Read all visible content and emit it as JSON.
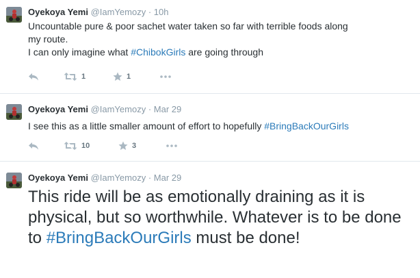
{
  "tweets": [
    {
      "name": "Oyekoya Yemi",
      "handle": "@IamYemozy",
      "dot": "·",
      "time": "10h",
      "text_line1": "Uncountable pure & poor sachet water taken so far with terrible foods along",
      "text_line2": "my route.",
      "text_line3_prefix": "I can only imagine what ",
      "text_line3_hashtag": "#ChibokGirls",
      "text_line3_suffix": " are going through",
      "retweets": "1",
      "favorites": "1"
    },
    {
      "name": "Oyekoya Yemi",
      "handle": "@IamYemozy",
      "dot": "·",
      "time": "Mar 29",
      "text_prefix": "I see this as a little smaller amount of effort to hopefully ",
      "text_hashtag": "#BringBackOurGirls",
      "retweets": "10",
      "favorites": "3"
    },
    {
      "name": "Oyekoya Yemi",
      "handle": "@IamYemozy",
      "dot": "·",
      "time": "Mar 29",
      "text_prefix": "This ride will be as emotionally draining as it is physical, but so worthwhile. Whatever is to be done to ",
      "text_hashtag": "#BringBackOurGirls",
      "text_suffix": " must be done!"
    }
  ],
  "icons": {
    "reply": "reply-icon",
    "retweet": "retweet-icon",
    "favorite": "star-icon",
    "more": "more-icon"
  },
  "colors": {
    "hashtag": "#2b7bb9",
    "muted": "#8899a6",
    "text": "#292f33",
    "separator": "#e1e8ed"
  }
}
